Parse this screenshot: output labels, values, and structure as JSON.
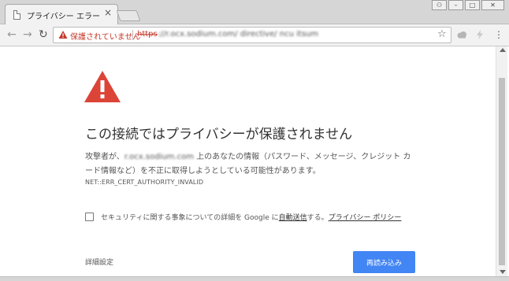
{
  "tab": {
    "title": "プライバシー エラー",
    "close": "×"
  },
  "window_controls": {
    "user": "⚇",
    "minimize": "–",
    "maximize": "□",
    "close": "✕"
  },
  "toolbar": {
    "back": "←",
    "forward": "→",
    "reload": "↻",
    "security_status": "保護されていません",
    "scheme": "https",
    "url": "://r.ocx.sodium.com/  directive/  ncu    itsum",
    "star": "☆",
    "menu": "⋮"
  },
  "colors": {
    "warning_red": "#db4437",
    "button_blue": "#4285f4",
    "status_red": "#c53929"
  },
  "interstitial": {
    "heading": "この接続ではプライバシーが保護されません",
    "para_prefix": "攻撃者が、",
    "blurred_host": "r.ocx.sodium.com",
    "para_suffix": " 上のあなたの情報（パスワード、メッセージ、クレジット カード情報など）を不正に取得しようとしている可能性があります。",
    "error_code": "NET::ERR_CERT_AUTHORITY_INVALID",
    "checkbox_prefix": "セキュリティに関する事象についての詳細を Google に",
    "checkbox_link1": "自動送信",
    "checkbox_mid": "する。",
    "checkbox_link2": "プライバシー ポリシー",
    "details": "詳細設定",
    "reload_button": "再読み込み"
  }
}
